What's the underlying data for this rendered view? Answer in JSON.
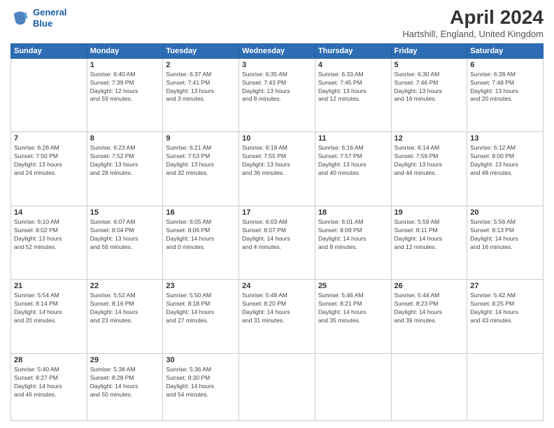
{
  "header": {
    "logo_line1": "General",
    "logo_line2": "Blue",
    "month_title": "April 2024",
    "location": "Hartshill, England, United Kingdom"
  },
  "weekdays": [
    "Sunday",
    "Monday",
    "Tuesday",
    "Wednesday",
    "Thursday",
    "Friday",
    "Saturday"
  ],
  "weeks": [
    [
      {
        "day": "",
        "info": ""
      },
      {
        "day": "1",
        "info": "Sunrise: 6:40 AM\nSunset: 7:39 PM\nDaylight: 12 hours\nand 59 minutes."
      },
      {
        "day": "2",
        "info": "Sunrise: 6:37 AM\nSunset: 7:41 PM\nDaylight: 13 hours\nand 3 minutes."
      },
      {
        "day": "3",
        "info": "Sunrise: 6:35 AM\nSunset: 7:43 PM\nDaylight: 13 hours\nand 8 minutes."
      },
      {
        "day": "4",
        "info": "Sunrise: 6:33 AM\nSunset: 7:45 PM\nDaylight: 13 hours\nand 12 minutes."
      },
      {
        "day": "5",
        "info": "Sunrise: 6:30 AM\nSunset: 7:46 PM\nDaylight: 13 hours\nand 16 minutes."
      },
      {
        "day": "6",
        "info": "Sunrise: 6:28 AM\nSunset: 7:48 PM\nDaylight: 13 hours\nand 20 minutes."
      }
    ],
    [
      {
        "day": "7",
        "info": "Sunrise: 6:26 AM\nSunset: 7:50 PM\nDaylight: 13 hours\nand 24 minutes."
      },
      {
        "day": "8",
        "info": "Sunrise: 6:23 AM\nSunset: 7:52 PM\nDaylight: 13 hours\nand 28 minutes."
      },
      {
        "day": "9",
        "info": "Sunrise: 6:21 AM\nSunset: 7:53 PM\nDaylight: 13 hours\nand 32 minutes."
      },
      {
        "day": "10",
        "info": "Sunrise: 6:19 AM\nSunset: 7:55 PM\nDaylight: 13 hours\nand 36 minutes."
      },
      {
        "day": "11",
        "info": "Sunrise: 6:16 AM\nSunset: 7:57 PM\nDaylight: 13 hours\nand 40 minutes."
      },
      {
        "day": "12",
        "info": "Sunrise: 6:14 AM\nSunset: 7:59 PM\nDaylight: 13 hours\nand 44 minutes."
      },
      {
        "day": "13",
        "info": "Sunrise: 6:12 AM\nSunset: 8:00 PM\nDaylight: 13 hours\nand 48 minutes."
      }
    ],
    [
      {
        "day": "14",
        "info": "Sunrise: 6:10 AM\nSunset: 8:02 PM\nDaylight: 13 hours\nand 52 minutes."
      },
      {
        "day": "15",
        "info": "Sunrise: 6:07 AM\nSunset: 8:04 PM\nDaylight: 13 hours\nand 56 minutes."
      },
      {
        "day": "16",
        "info": "Sunrise: 6:05 AM\nSunset: 8:06 PM\nDaylight: 14 hours\nand 0 minutes."
      },
      {
        "day": "17",
        "info": "Sunrise: 6:03 AM\nSunset: 8:07 PM\nDaylight: 14 hours\nand 4 minutes."
      },
      {
        "day": "18",
        "info": "Sunrise: 6:01 AM\nSunset: 8:09 PM\nDaylight: 14 hours\nand 8 minutes."
      },
      {
        "day": "19",
        "info": "Sunrise: 5:59 AM\nSunset: 8:11 PM\nDaylight: 14 hours\nand 12 minutes."
      },
      {
        "day": "20",
        "info": "Sunrise: 5:56 AM\nSunset: 8:13 PM\nDaylight: 14 hours\nand 16 minutes."
      }
    ],
    [
      {
        "day": "21",
        "info": "Sunrise: 5:54 AM\nSunset: 8:14 PM\nDaylight: 14 hours\nand 20 minutes."
      },
      {
        "day": "22",
        "info": "Sunrise: 5:52 AM\nSunset: 8:16 PM\nDaylight: 14 hours\nand 23 minutes."
      },
      {
        "day": "23",
        "info": "Sunrise: 5:50 AM\nSunset: 8:18 PM\nDaylight: 14 hours\nand 27 minutes."
      },
      {
        "day": "24",
        "info": "Sunrise: 5:48 AM\nSunset: 8:20 PM\nDaylight: 14 hours\nand 31 minutes."
      },
      {
        "day": "25",
        "info": "Sunrise: 5:46 AM\nSunset: 8:21 PM\nDaylight: 14 hours\nand 35 minutes."
      },
      {
        "day": "26",
        "info": "Sunrise: 5:44 AM\nSunset: 8:23 PM\nDaylight: 14 hours\nand 39 minutes."
      },
      {
        "day": "27",
        "info": "Sunrise: 5:42 AM\nSunset: 8:25 PM\nDaylight: 14 hours\nand 43 minutes."
      }
    ],
    [
      {
        "day": "28",
        "info": "Sunrise: 5:40 AM\nSunset: 8:27 PM\nDaylight: 14 hours\nand 46 minutes."
      },
      {
        "day": "29",
        "info": "Sunrise: 5:38 AM\nSunset: 8:28 PM\nDaylight: 14 hours\nand 50 minutes."
      },
      {
        "day": "30",
        "info": "Sunrise: 5:36 AM\nSunset: 8:30 PM\nDaylight: 14 hours\nand 54 minutes."
      },
      {
        "day": "",
        "info": ""
      },
      {
        "day": "",
        "info": ""
      },
      {
        "day": "",
        "info": ""
      },
      {
        "day": "",
        "info": ""
      }
    ]
  ]
}
